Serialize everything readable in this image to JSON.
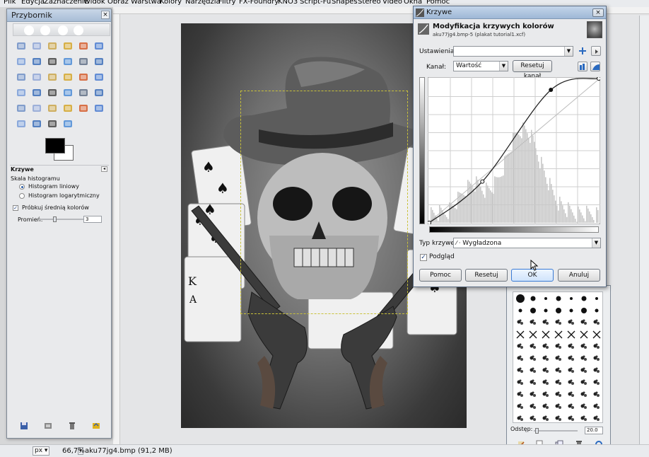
{
  "menubar": {
    "items": [
      "Plik",
      "Edycja",
      "Zaznaczenie",
      "Widok",
      "Obraz",
      "Warstwa",
      "Kolory",
      "Narzędzia",
      "Filtry",
      "FX-Foundry",
      "KNO3",
      "Script-Fu",
      "Shapes",
      "Stereo",
      "Video",
      "Okna",
      "Pomoc"
    ]
  },
  "toolbox": {
    "title": "Przybornik",
    "close_glyph": "×",
    "tab_menu_glyph": "◂",
    "options_title": "Krzywe",
    "histogram_scale_label": "Skala histogramu",
    "histogram_linear": "Histogram liniowy",
    "histogram_log": "Histogram logarytmiczny",
    "sample_average_label": "Próbkuj średnią kolorów",
    "sample_average_checked": true,
    "radius_label": "Promień:",
    "radius_value": "3",
    "foreground_color": "#000000",
    "background_color": "#ffffff"
  },
  "statusbar": {
    "unit": "px",
    "zoom": "66,7%",
    "file_info": "aku77jg4.bmp (91,2 MB)"
  },
  "curves": {
    "window_title": "Krzywe",
    "close_glyph": "×",
    "heading": "Modyfikacja krzywych kolorów",
    "subheading": "aku77jg4.bmp-5 (plakat tutorial1.xcf)",
    "presets_label": "Ustawienia:",
    "presets_value": "",
    "channel_label": "Kanał:",
    "channel_value": "Wartość",
    "reset_channel_label": "Resetuj kanał",
    "curve_type_label": "Typ krzywej:",
    "curve_type_value": "Wygładzona",
    "preview_label": "Podgląd",
    "preview_checked": true,
    "buttons": {
      "help": "Pomoc",
      "reset": "Resetuj",
      "ok": "OK",
      "cancel": "Anuluj"
    },
    "curve_points": [
      [
        0,
        0
      ],
      [
        80,
        73
      ],
      [
        183,
        235
      ],
      [
        255,
        255
      ]
    ]
  },
  "brushes": {
    "spacing_label": "Odstęp:",
    "spacing_value": "20.0"
  },
  "colors": {
    "selection_border": "#c9c13a",
    "dialog_title_bar": "#b5cbe3",
    "ok_button_focus": "#3a7bd5"
  }
}
